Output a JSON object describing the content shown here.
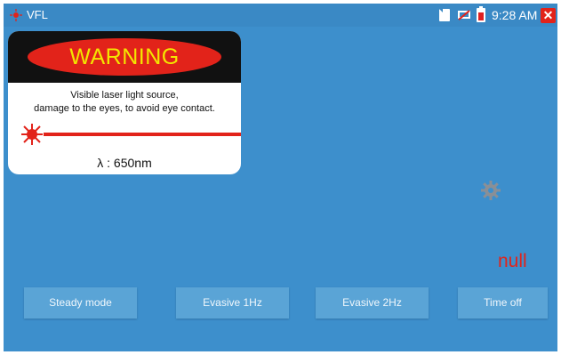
{
  "statusbar": {
    "app_title": "VFL",
    "time": "9:28 AM",
    "icons": [
      "sim-card-icon",
      "network-disconnected-icon",
      "battery-charging-icon",
      "close-icon"
    ]
  },
  "warning": {
    "header": "WARNING",
    "line1": "Visible laser light source,",
    "line2": "damage to the eyes, to avoid eye contact.",
    "wavelength": "λ : 650nm"
  },
  "status_value": "null",
  "buttons": {
    "steady": "Steady mode",
    "evasive1": "Evasive 1Hz",
    "evasive2": "Evasive 2Hz",
    "time_off": "Time off"
  },
  "colors": {
    "background": "#3d8fcc",
    "button": "#5aa4d6",
    "accent_red": "#e2231a",
    "warning_yellow": "#f3e600"
  }
}
